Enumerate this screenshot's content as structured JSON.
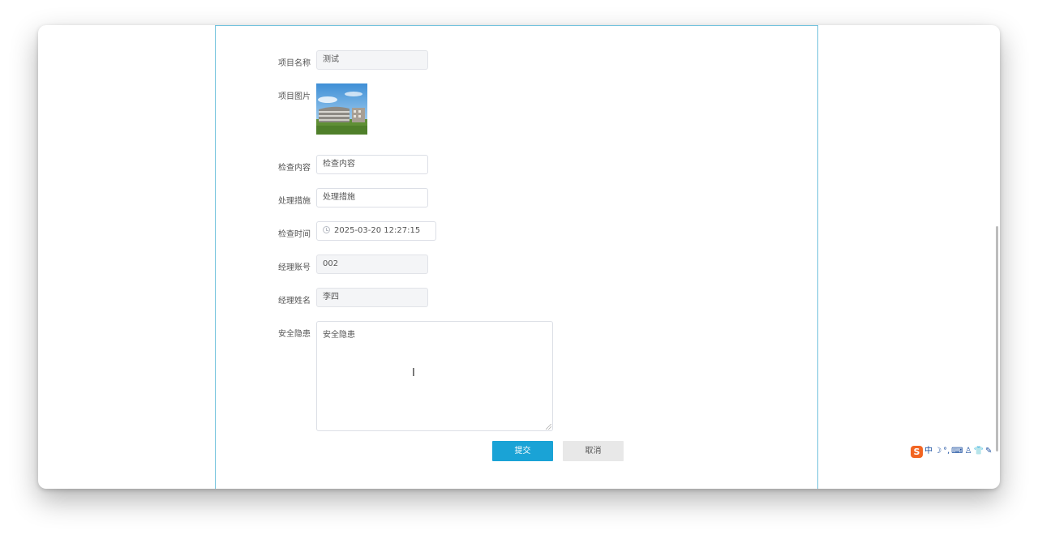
{
  "form": {
    "project_name": {
      "label": "项目名称",
      "value": "测试"
    },
    "project_image": {
      "label": "项目图片"
    },
    "inspect_content": {
      "label": "检查内容",
      "value": "检查内容"
    },
    "measures": {
      "label": "处理措施",
      "value": "处理措施"
    },
    "inspect_time": {
      "label": "检查时间",
      "value": "2025-03-20 12:27:15"
    },
    "manager_account": {
      "label": "经理账号",
      "value": "002"
    },
    "manager_name": {
      "label": "经理姓名",
      "value": "李四"
    },
    "hazard": {
      "label": "安全隐患",
      "value": "安全隐患"
    }
  },
  "buttons": {
    "submit": "提交",
    "cancel": "取消"
  },
  "ime_toolbar": {
    "logo": "S",
    "mode": "中",
    "items": [
      "☽",
      "°,",
      "⌨",
      "♙",
      "👕",
      "✎"
    ]
  },
  "colors": {
    "frame_border": "#73c2dd",
    "primary_button": "#1aa3d6",
    "default_button": "#e8e8e8",
    "readonly_bg": "#f4f5f7"
  }
}
